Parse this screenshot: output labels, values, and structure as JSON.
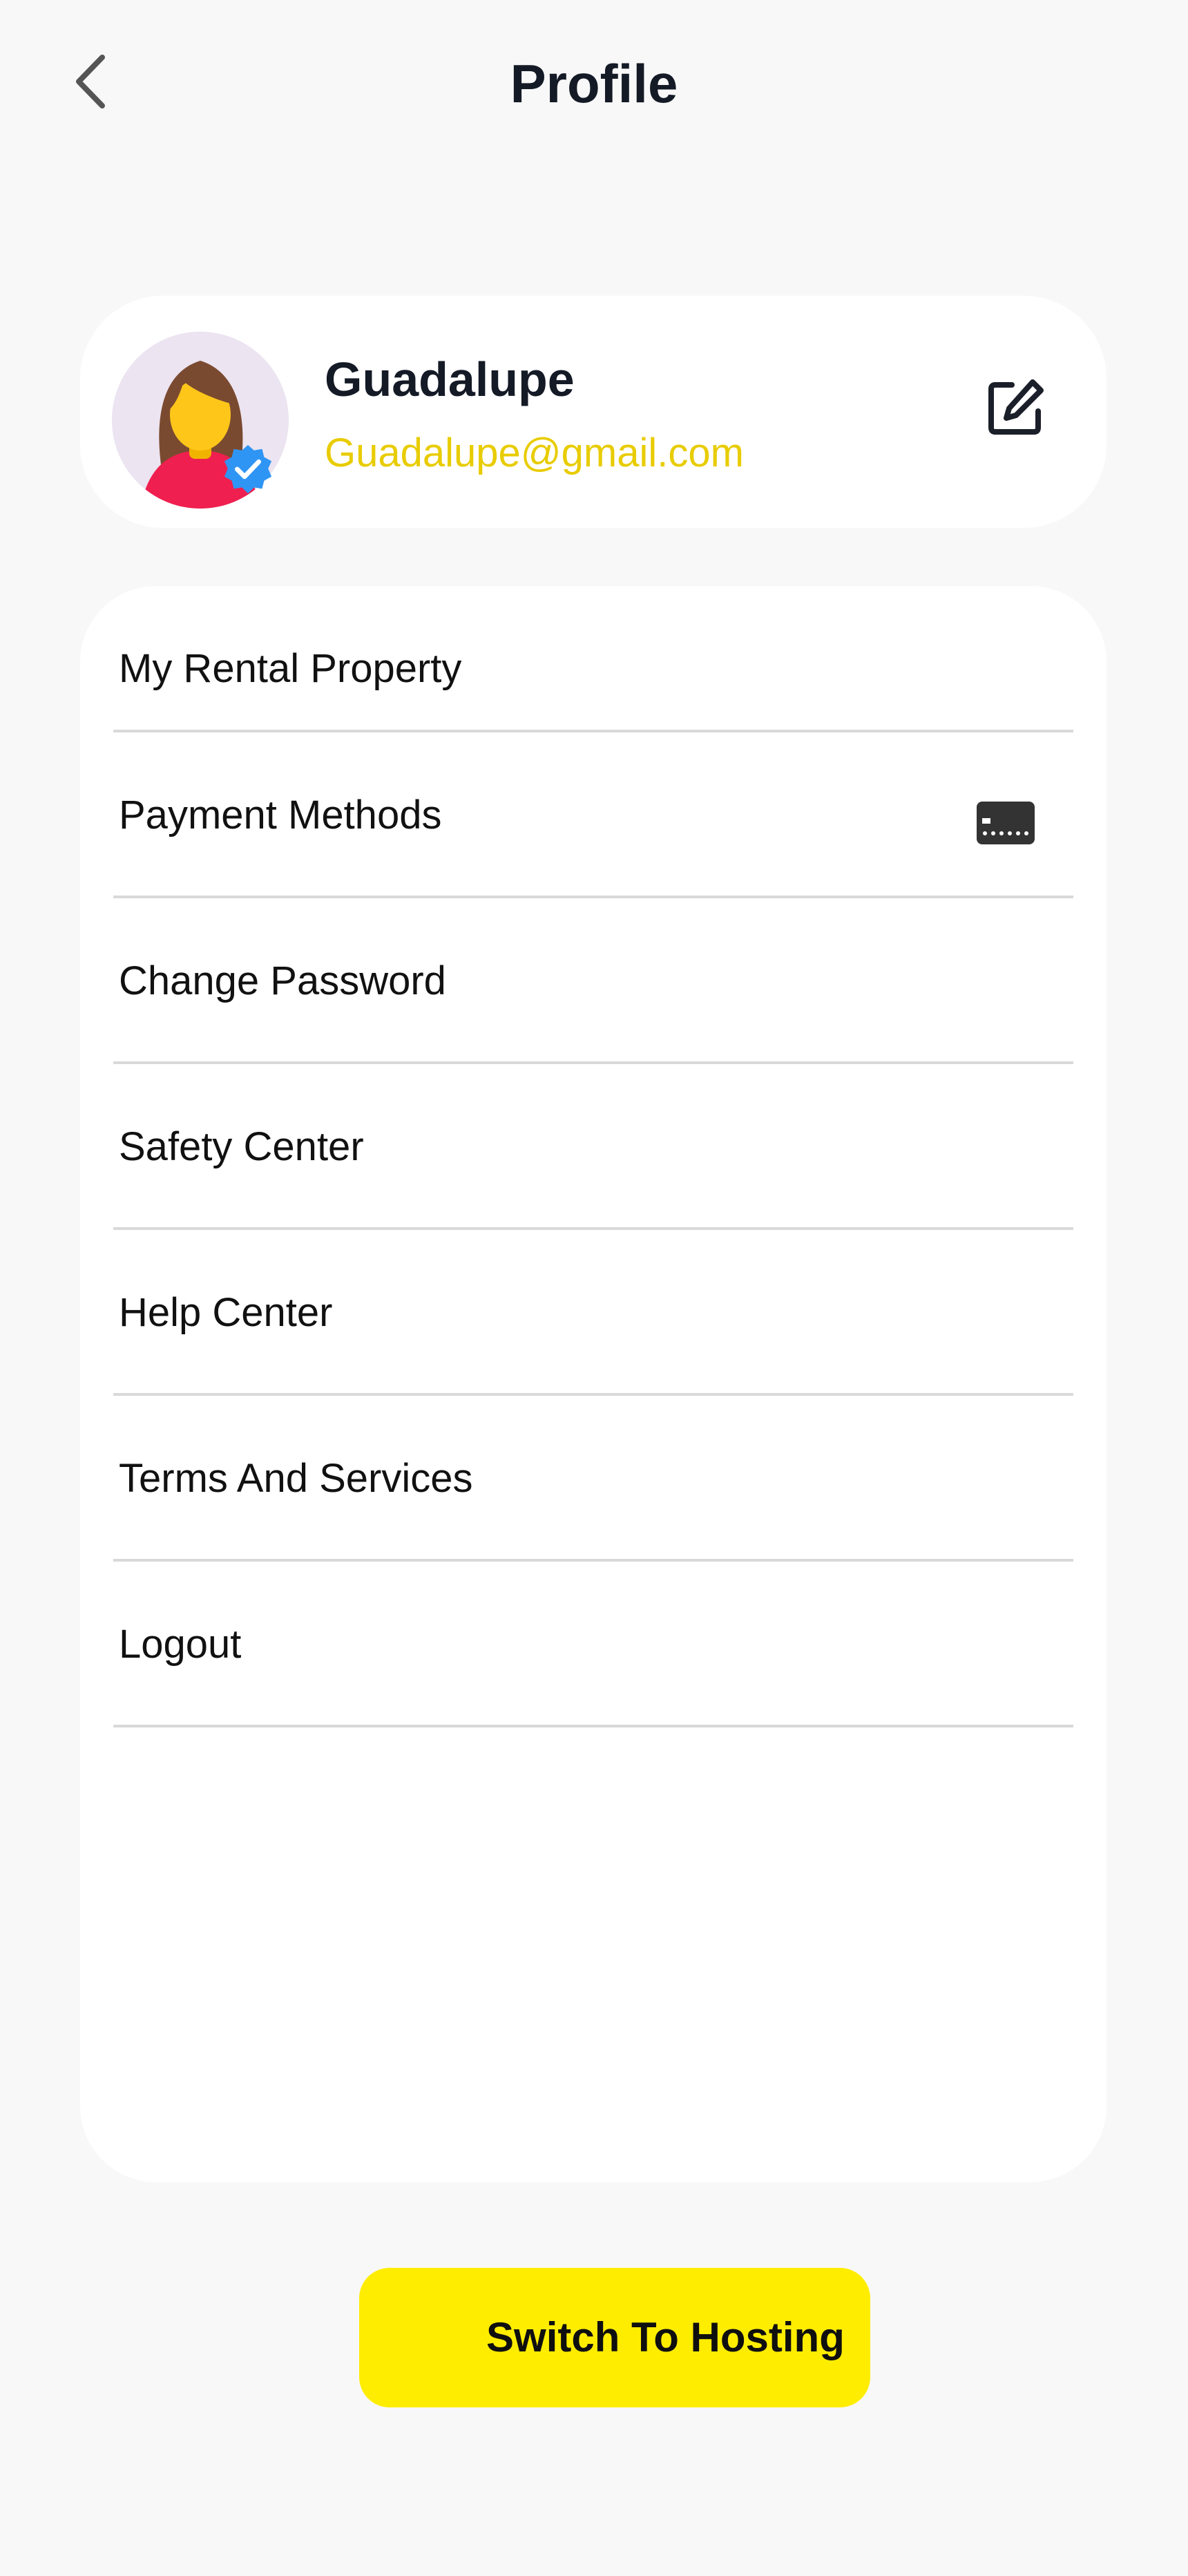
{
  "header": {
    "title": "Profile",
    "back_icon": "chevron-left-icon"
  },
  "profile": {
    "name": "Guadalupe",
    "email": "Guadalupe@gmail.com",
    "avatar_icon": "woman-avatar",
    "verified_icon": "verified-badge-icon",
    "edit_icon": "edit-icon"
  },
  "menu": {
    "items": [
      {
        "label": "My Rental Property"
      },
      {
        "label": "Payment Methods",
        "icon": "credit-card-icon"
      },
      {
        "label": "Change Password"
      },
      {
        "label": "Safety Center"
      },
      {
        "label": "Help Center"
      },
      {
        "label": "Terms And Services"
      },
      {
        "label": "Logout"
      }
    ]
  },
  "footer": {
    "switch_label": "Switch To Hosting"
  },
  "colors": {
    "background": "#f8f8f8",
    "accent_yellow": "#ffed00",
    "email_yellow": "#e8cc00",
    "title_dark": "#141a26",
    "divider": "#d9d9d9",
    "verified_blue": "#2f95f5"
  }
}
